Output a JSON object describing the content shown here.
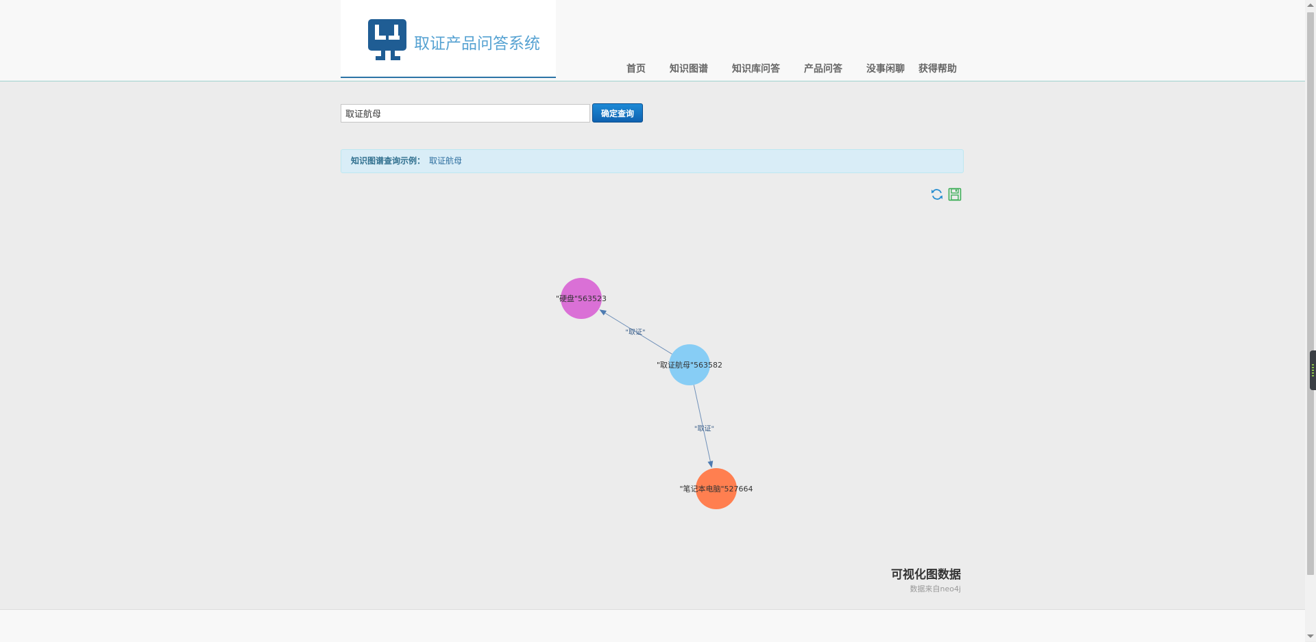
{
  "brand": {
    "logo_icon": "qa-logo-icon",
    "title": "取证产品问答系统",
    "title_color": "#56a2d2",
    "logo_color": "#1f5d94"
  },
  "nav": {
    "items": [
      {
        "label": "首页"
      },
      {
        "label": "知识图谱"
      },
      {
        "label": "知识库问答"
      },
      {
        "label": "产品问答"
      },
      {
        "label": "没事闲聊"
      },
      {
        "label": "获得帮助"
      }
    ]
  },
  "search": {
    "value": "取证航母",
    "button_label": "确定查询"
  },
  "hint": {
    "label": "知识图谱查询示例：",
    "example": "取证航母"
  },
  "toolbar": {
    "refresh_icon": "refresh-icon",
    "save_icon": "save-icon"
  },
  "graph": {
    "nodes": [
      {
        "id": "center",
        "label": "\"取证航母\"563582",
        "color": "#87cdf5"
      },
      {
        "id": "disk",
        "label": "\"硬盘\"563523",
        "color": "#da70d6"
      },
      {
        "id": "laptop",
        "label": "\"笔记本电脑\"527664",
        "color": "#ff7f50"
      }
    ],
    "edges": [
      {
        "source": "center",
        "target": "disk",
        "label": "\"取证\""
      },
      {
        "source": "center",
        "target": "laptop",
        "label": "\"取证\""
      }
    ],
    "edge_color": "#6e8fb8"
  },
  "visualization": {
    "title": "可视化图数据",
    "subtitle": "数据来自neo4j"
  }
}
